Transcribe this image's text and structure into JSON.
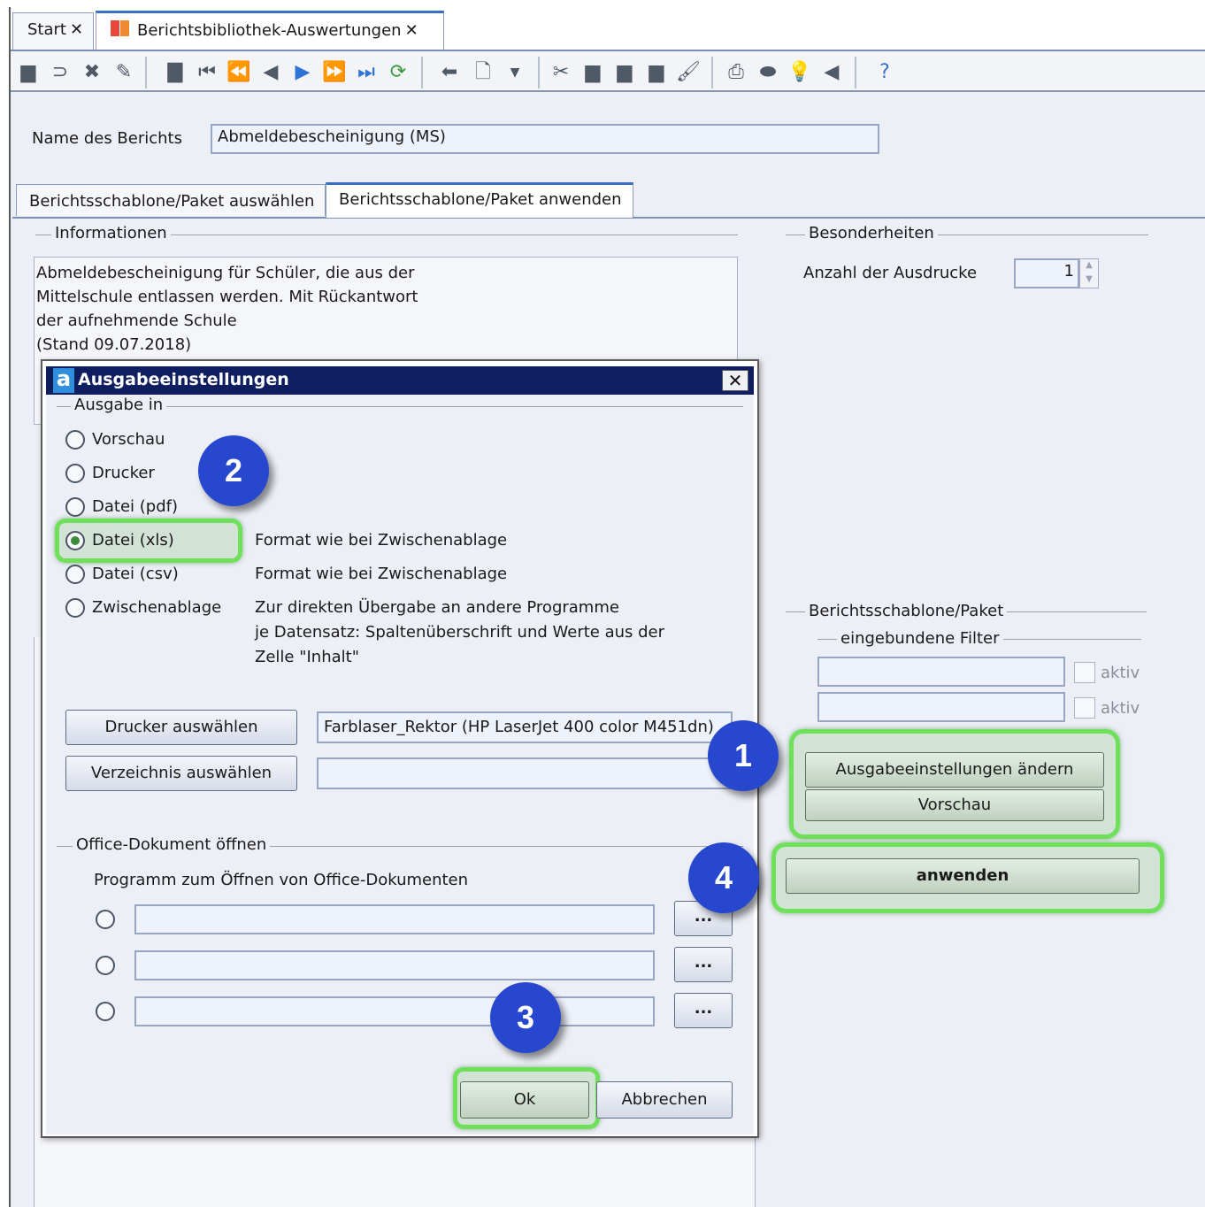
{
  "tabs": [
    {
      "label": "Start",
      "close": "✕"
    },
    {
      "label": "Berichtsbibliothek-Auswertungen",
      "close": "✕"
    }
  ],
  "toolbar_icons": [
    "save-icon",
    "undo-icon",
    "delete-icon",
    "edit-icon",
    "copy-record-icon",
    "first-icon",
    "fast-back-icon",
    "back-icon",
    "forward-icon",
    "fast-forward-icon",
    "last-icon",
    "refresh-icon",
    "back-arrow-icon",
    "new-document-icon",
    "dropdown-icon",
    "cut-icon",
    "copy-icon",
    "paste-icon",
    "paste-special-icon",
    "format-painter-icon",
    "print-icon",
    "preview-icon",
    "hint-icon",
    "clear-icon",
    "help-icon"
  ],
  "report": {
    "name_label": "Name des Berichts",
    "name_value": "Abmeldebescheinigung (MS)"
  },
  "subtabs": [
    "Berichtsschablone/Paket auswählen",
    "Berichtsschablone/Paket anwenden"
  ],
  "info": {
    "title": "Informationen",
    "lines": [
      "Abmeldebescheinigung für Schüler, die aus der",
      "Mittelschule entlassen werden. Mit Rückantwort",
      "der aufnehmende Schule",
      "(Stand 09.07.2018)"
    ]
  },
  "besonderheiten": {
    "title": "Besonderheiten",
    "copies_label": "Anzahl der Ausdrucke",
    "copies_value": "1"
  },
  "paket": {
    "title": "Berichtsschablone/Paket",
    "filter_title": "eingebundene Filter",
    "filters": [
      {
        "value": "",
        "active_label": "aktiv"
      },
      {
        "value": "",
        "active_label": "aktiv"
      }
    ],
    "btn_settings": "Ausgabeeinstellungen ändern",
    "btn_preview": "Vorschau",
    "btn_apply": "anwenden"
  },
  "dialog": {
    "title": "Ausgabeeinstellungen",
    "close": "✕",
    "group_output": "Ausgabe in",
    "options": [
      {
        "label": "Vorschau",
        "desc": ""
      },
      {
        "label": "Drucker",
        "desc": ""
      },
      {
        "label": "Datei (pdf)",
        "desc": ""
      },
      {
        "label": "Datei (xls)",
        "desc": "Format wie bei Zwischenablage"
      },
      {
        "label": "Datei (csv)",
        "desc": "Format wie bei Zwischenablage"
      },
      {
        "label": "Zwischenablage",
        "desc": "Zur direkten Übergabe an andere Programme"
      }
    ],
    "clipboard_desc_2": "je Datensatz: Spaltenüberschrift und Werte aus der",
    "clipboard_desc_3": "Zelle \"Inhalt\"",
    "selected_option": "Datei (xls)",
    "btn_printer": "Drucker auswählen",
    "printer_value": "Farblaser_Rektor (HP LaserJet 400 color M451dn)",
    "btn_directory": "Verzeichnis auswählen",
    "directory_value": "",
    "group_office": "Office-Dokument öffnen",
    "office_prompt": "Programm zum Öffnen von Office-Dokumenten",
    "office_programs": [
      {
        "value": "",
        "browse": "..."
      },
      {
        "value": "",
        "browse": "..."
      },
      {
        "value": "",
        "browse": "..."
      }
    ],
    "btn_ok": "Ok",
    "btn_cancel": "Abbrechen"
  },
  "annotations": {
    "badge_1": "1",
    "badge_2": "2",
    "badge_3": "3",
    "badge_4": "4",
    "highlight_color": "#6ee05a",
    "badge_color": "#2747cf"
  }
}
